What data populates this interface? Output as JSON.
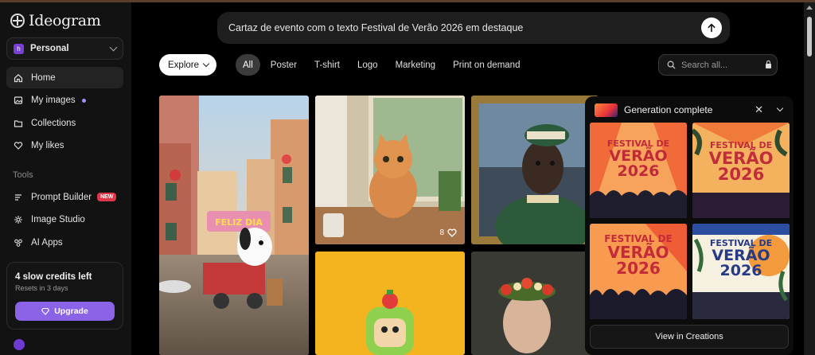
{
  "app": {
    "brand": "Ideogram"
  },
  "workspace": {
    "avatar_letter": "h",
    "label": "Personal"
  },
  "nav": [
    {
      "label": "Home",
      "icon": "home-icon"
    },
    {
      "label": "My images",
      "icon": "images-icon"
    },
    {
      "label": "Collections",
      "icon": "folder-icon"
    },
    {
      "label": "My likes",
      "icon": "heart-icon"
    }
  ],
  "tools": {
    "heading": "Tools",
    "items": [
      {
        "label": "Prompt Builder",
        "badge": "NEW"
      },
      {
        "label": "Image Studio"
      },
      {
        "label": "AI Apps"
      }
    ]
  },
  "credits": {
    "title": "4 slow credits left",
    "subtitle": "Resets in 3 days",
    "upgrade_label": "Upgrade"
  },
  "prompt": {
    "text": "Cartaz de evento com o texto Festival de Verão 2026 em destaque"
  },
  "filters": {
    "explore_label": "Explore",
    "chips": [
      "All",
      "Poster",
      "T-shirt",
      "Logo",
      "Marketing",
      "Print on demand"
    ],
    "active": "All"
  },
  "search": {
    "placeholder": "Search all..."
  },
  "gallery": {
    "cafe_sign": "FELIZ DIA",
    "cat_likes": "8"
  },
  "notification": {
    "title": "Generation complete",
    "poster_line1": "FESTIVAL DE",
    "poster_line2": "VERÃO",
    "poster_line3": "2026",
    "view_label": "View in Creations"
  },
  "colors": {
    "accent": "#8a63e6",
    "new_badge": "#e0364a",
    "background": "#000000"
  }
}
